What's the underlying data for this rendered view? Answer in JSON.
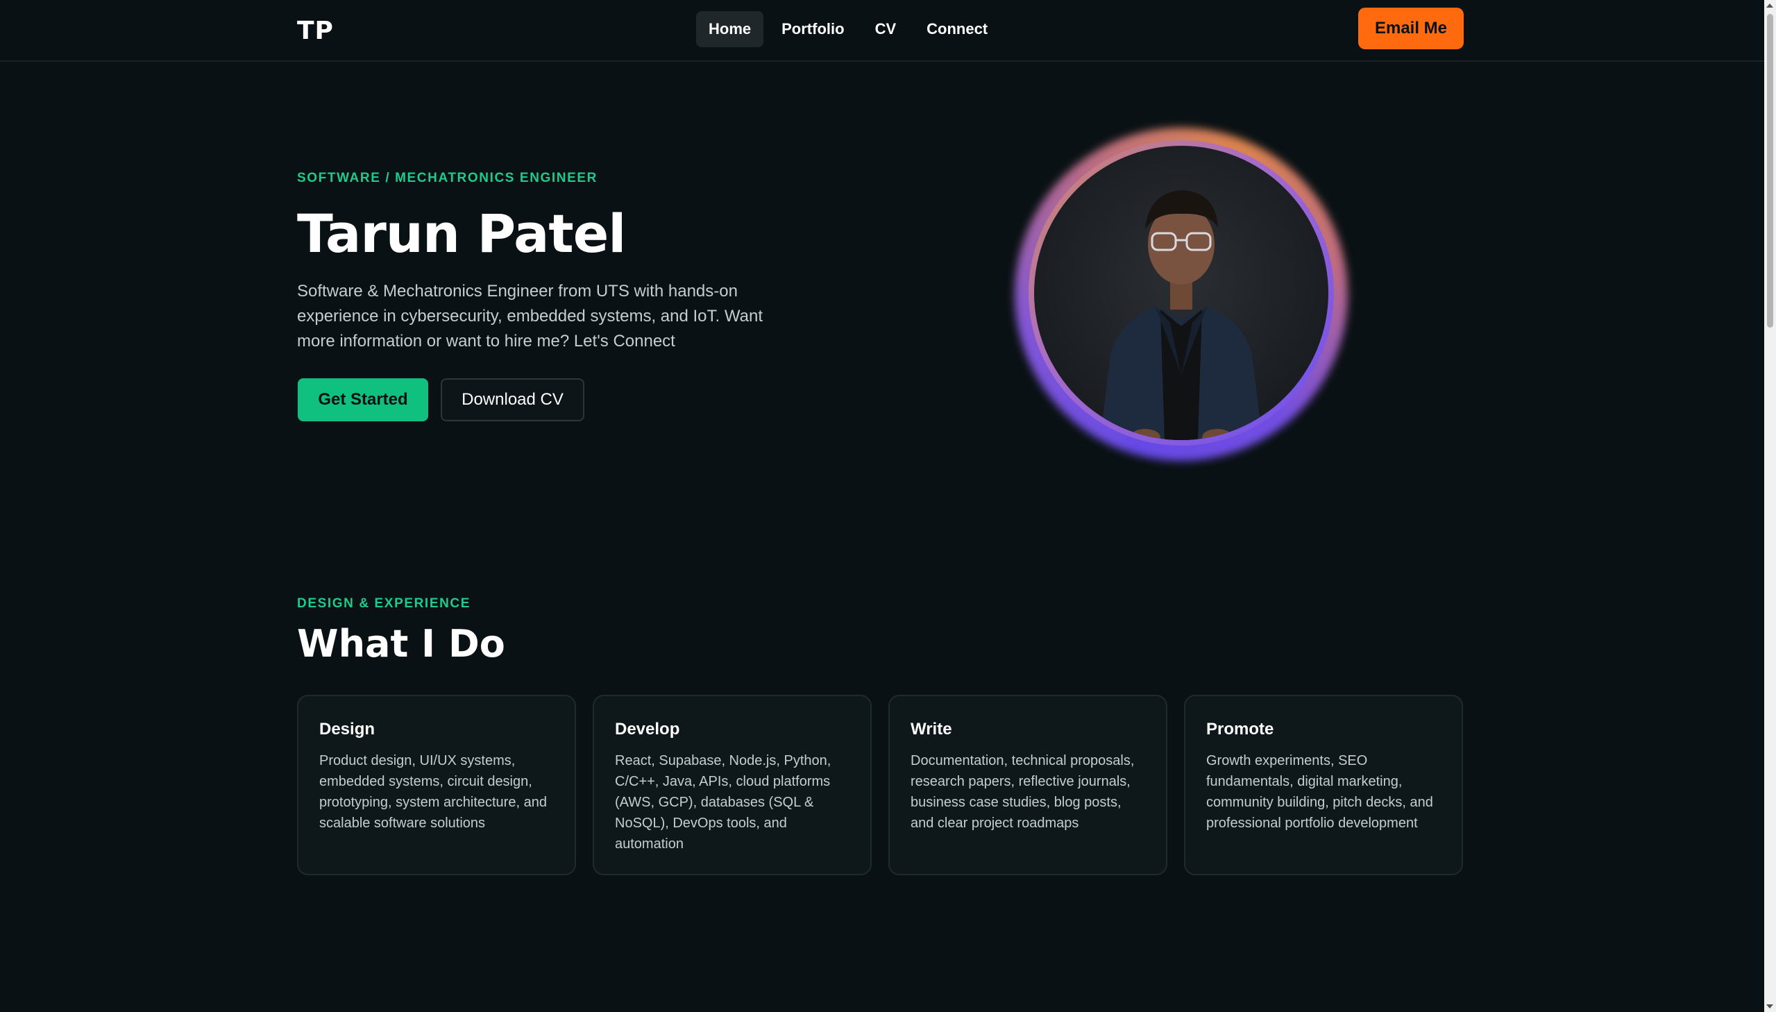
{
  "nav": {
    "logo": "TP",
    "links": [
      {
        "label": "Home",
        "active": true
      },
      {
        "label": "Portfolio"
      },
      {
        "label": "CV"
      },
      {
        "label": "Connect"
      }
    ],
    "cta": "Email Me"
  },
  "hero": {
    "eyebrow": "SOFTWARE / MECHATRONICS ENGINEER",
    "title": "Tarun Patel",
    "description": "Software & Mechatronics Engineer from UTS with hands-on experience in cybersecurity, embedded systems, and IoT. Want more information or want to hire me? Let's Connect",
    "primary_button": "Get Started",
    "secondary_button": "Download CV"
  },
  "section": {
    "eyebrow": "DESIGN & EXPERIENCE",
    "title": "What I Do",
    "cards": [
      {
        "title": "Design",
        "text": "Product design, UI/UX systems, embedded systems, circuit design, prototyping, system architecture, and scalable software solutions"
      },
      {
        "title": "Develop",
        "text": "React, Supabase, Node.js, Python, C/C++, Java, APIs, cloud platforms (AWS, GCP), databases (SQL & NoSQL), DevOps tools, and automation"
      },
      {
        "title": "Write",
        "text": "Documentation, technical proposals, research papers, reflective journals, business case studies, blog posts, and clear project roadmaps"
      },
      {
        "title": "Promote",
        "text": "Growth experiments, SEO fundamentals, digital marketing, community building, pitch decks, and professional portfolio development"
      }
    ]
  },
  "colors": {
    "background": "#0a1114",
    "accent_green": "#10c07f",
    "accent_orange": "#ff6a0e",
    "ring_purple": "#6a4ef0"
  }
}
